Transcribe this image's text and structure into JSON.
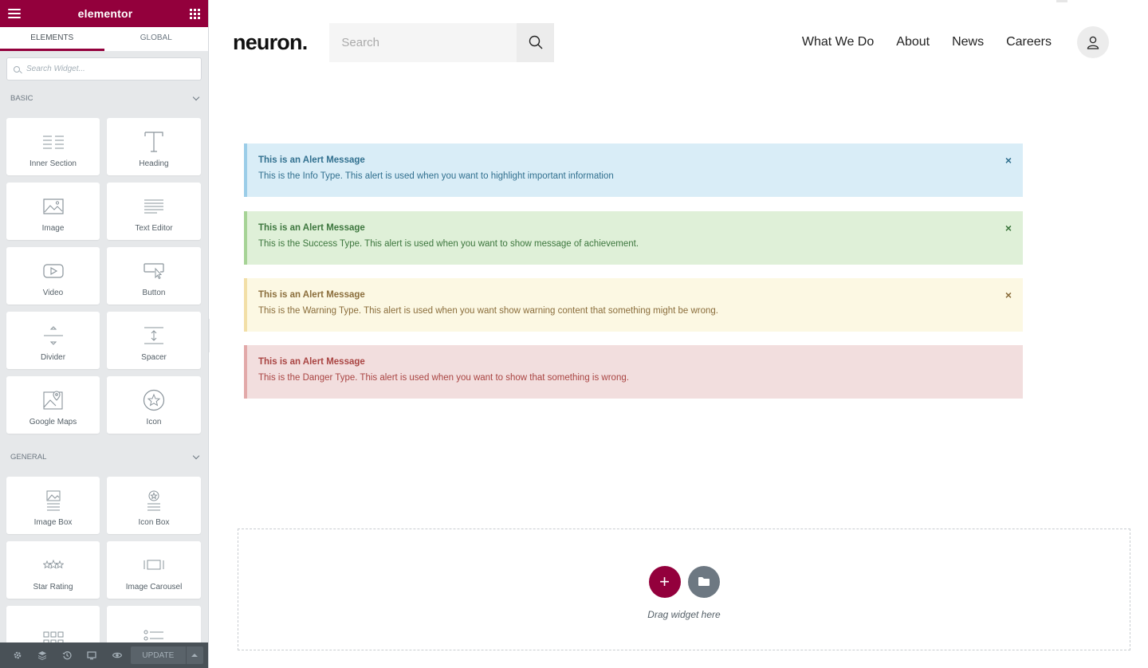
{
  "editor": {
    "brand": "elementor",
    "tabs": [
      "ELEMENTS",
      "GLOBAL"
    ],
    "search_placeholder": "Search Widget...",
    "categories": [
      {
        "title": "BASIC",
        "widgets": [
          {
            "label": "Inner Section",
            "icon": "inner-section-icon"
          },
          {
            "label": "Heading",
            "icon": "heading-icon"
          },
          {
            "label": "Image",
            "icon": "image-icon"
          },
          {
            "label": "Text Editor",
            "icon": "text-editor-icon"
          },
          {
            "label": "Video",
            "icon": "video-icon"
          },
          {
            "label": "Button",
            "icon": "button-icon"
          },
          {
            "label": "Divider",
            "icon": "divider-icon"
          },
          {
            "label": "Spacer",
            "icon": "spacer-icon"
          },
          {
            "label": "Google Maps",
            "icon": "google-maps-icon"
          },
          {
            "label": "Icon",
            "icon": "star-icon"
          }
        ]
      },
      {
        "title": "GENERAL",
        "widgets": [
          {
            "label": "Image Box",
            "icon": "image-box-icon"
          },
          {
            "label": "Icon Box",
            "icon": "icon-box-icon"
          },
          {
            "label": "Star Rating",
            "icon": "star-rating-icon"
          },
          {
            "label": "Image Carousel",
            "icon": "image-carousel-icon"
          }
        ]
      }
    ],
    "footer": {
      "update_label": "UPDATE"
    }
  },
  "site": {
    "logo": "neuron.",
    "search_placeholder": "Search",
    "nav": [
      "What We Do",
      "About",
      "News",
      "Careers"
    ],
    "alerts": [
      {
        "type": "info",
        "title": "This is an Alert Message",
        "text": "This is the Info Type. This alert is used when you want to highlight important information",
        "close": "×"
      },
      {
        "type": "success",
        "title": "This is an Alert Message",
        "text": "This is the Success Type. This alert is used when you want to show message of achievement.",
        "close": "×"
      },
      {
        "type": "warning",
        "title": "This is an Alert Message",
        "text": "This is the Warning Type. This alert is used when you want show warning content that something might be wrong.",
        "close": "×"
      },
      {
        "type": "danger",
        "title": "This is an Alert Message",
        "text": "This is the Danger Type. This alert is used when you want to show that something is wrong."
      }
    ],
    "drop_zone": {
      "add_symbol": "+",
      "text": "Drag widget here"
    }
  },
  "colors": {
    "accent": "#93003c",
    "panel_bg": "#e6e8ea",
    "footer_bg": "#495157"
  }
}
